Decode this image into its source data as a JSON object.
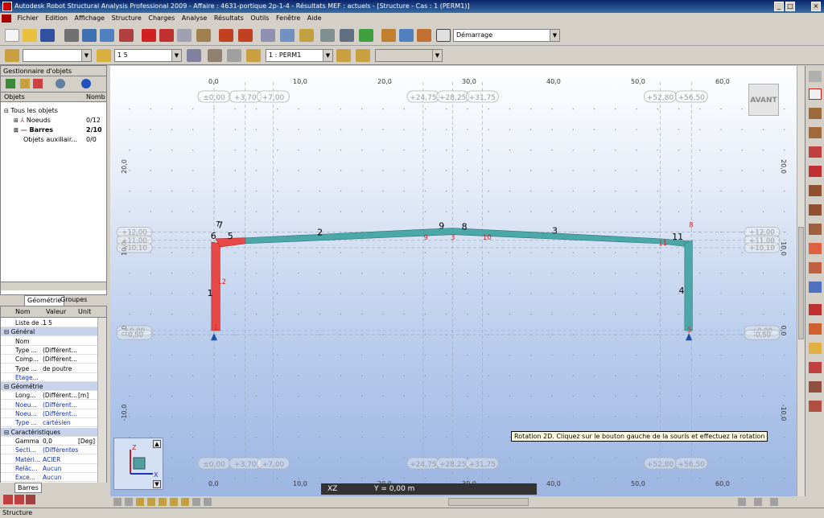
{
  "window": {
    "title": "Autodesk Robot Structural Analysis Professional 2009 - Affaire : 4631-portique 2p-1-4 - Résultats MEF : actuels - [Structure - Cas : 1 (PERM1)]"
  },
  "menu": [
    "Fichier",
    "Edition",
    "Affichage",
    "Structure",
    "Charges",
    "Analyse",
    "Résultats",
    "Outils",
    "Fenêtre",
    "Aide"
  ],
  "toolbar": {
    "layout_combo": "Démarrage",
    "selection_list": "1 5",
    "case_combo": "1 : PERM1"
  },
  "object_manager": {
    "title": "Gestionnaire d'objets",
    "col_objects": "Objets",
    "col_number": "Nomb",
    "tree": [
      {
        "label": "Tous les objets",
        "count": ""
      },
      {
        "label": "Noeuds",
        "count": "0/12"
      },
      {
        "label": "Barres",
        "count": "2/10"
      },
      {
        "label": "Objets auxiliair...",
        "count": "0/0"
      }
    ],
    "tabs": [
      "Géométrie",
      "Groupes"
    ]
  },
  "properties": {
    "headers": [
      "Nom",
      "Valeur",
      "Unit"
    ],
    "rows": [
      {
        "name": "Liste de ...",
        "value": "1 5",
        "unit": "",
        "type": "row"
      },
      {
        "name": "Général",
        "value": "",
        "unit": "",
        "type": "section"
      },
      {
        "name": "Nom",
        "value": "",
        "unit": "",
        "type": "row"
      },
      {
        "name": "Type ...",
        "value": "(Différent...",
        "unit": "",
        "type": "row"
      },
      {
        "name": "Comp...",
        "value": "(Différent...",
        "unit": "",
        "type": "row"
      },
      {
        "name": "Type ...",
        "value": "de poutre",
        "unit": "",
        "type": "row"
      },
      {
        "name": "Etage...",
        "value": "",
        "unit": "",
        "type": "blue"
      },
      {
        "name": "Géométrie",
        "value": "",
        "unit": "",
        "type": "section"
      },
      {
        "name": "Long...",
        "value": "(Différent...",
        "unit": "[m]",
        "type": "row"
      },
      {
        "name": "Noeu...",
        "value": "(Différent...",
        "unit": "",
        "type": "blue"
      },
      {
        "name": "Noeu...",
        "value": "(Différent...",
        "unit": "",
        "type": "blue"
      },
      {
        "name": "Type ...",
        "value": "cartésien",
        "unit": "",
        "type": "blue"
      },
      {
        "name": "Caractéristiques",
        "value": "",
        "unit": "",
        "type": "section"
      },
      {
        "name": "Gamma",
        "value": "0,0",
        "unit": "[Deg]",
        "type": "row"
      },
      {
        "name": "Secti...",
        "value": "(Différentes",
        "unit": "",
        "type": "blue"
      },
      {
        "name": "Matéri...",
        "value": "ACIER",
        "unit": "",
        "type": "blue"
      },
      {
        "name": "Reläc...",
        "value": "Aucun",
        "unit": "",
        "type": "blue"
      },
      {
        "name": "Exce...",
        "value": "Aucun",
        "unit": "",
        "type": "blue"
      }
    ],
    "tab": "Barres"
  },
  "viewport": {
    "x_ticks": [
      "0,0",
      "10,0",
      "20,0",
      "30,0",
      "40,0",
      "50,0",
      "60,0"
    ],
    "y_ticks": [
      "20,0",
      "10,0",
      "0,0",
      "-10,0"
    ],
    "top_levels": [
      "±0,00",
      "+3,70",
      "+7,00",
      "+24,75",
      "+28,25",
      "+31,75",
      "+52,80",
      "+56,50"
    ],
    "side_levels": [
      "+12,00",
      "+11,00",
      "+10,10",
      "±0,00",
      "-0,50"
    ],
    "bar_labels": [
      "1",
      "2",
      "3",
      "4",
      "5",
      "6",
      "7",
      "8",
      "9",
      "11"
    ],
    "node_labels": [
      "7",
      "8",
      "9",
      "10",
      "11",
      "12",
      "5",
      "3",
      "1"
    ],
    "view_cube": "AVANT",
    "plane": "XZ",
    "y_readout": "Y = 0,00 m",
    "tooltip": "Rotation 2D. Cliquez sur le bouton gauche de la souris et effectuez la rotation"
  },
  "status": "Structure",
  "colors": {
    "accent": "#0a246a",
    "beam": "#4aa8a8",
    "highlight": "#e84848"
  }
}
